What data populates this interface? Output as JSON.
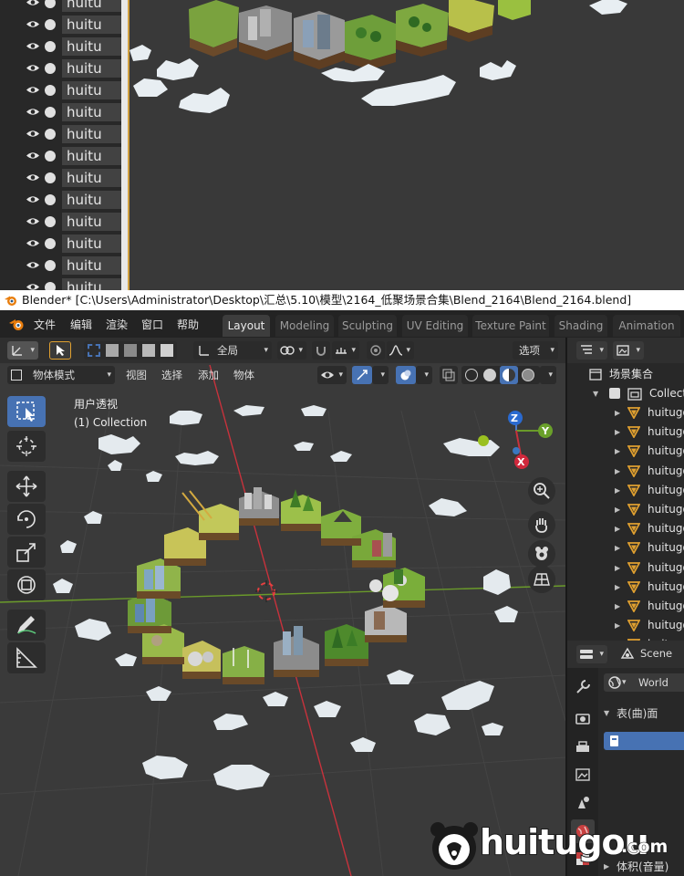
{
  "top_crop": {
    "rows": [
      "huitu",
      "huitu",
      "huitu",
      "huitu",
      "huitu",
      "huitu",
      "huitu",
      "huitu",
      "huitu",
      "huitu",
      "huitu",
      "huitu",
      "huitu",
      "huitu"
    ]
  },
  "title_bar": {
    "text": "Blender* [C:\\Users\\Administrator\\Desktop\\汇总\\5.10\\模型\\2164_低聚场景合集\\Blend_2164\\Blend_2164.blend]"
  },
  "menu": {
    "items": [
      "文件",
      "编辑",
      "渲染",
      "窗口",
      "帮助"
    ],
    "workspaces": [
      "Layout",
      "Modeling",
      "Sculpting",
      "UV Editing",
      "Texture Paint",
      "Shading",
      "Animation"
    ],
    "active_workspace": "Layout"
  },
  "viewport_header": {
    "pivot_label": "全局",
    "options_label": "选项",
    "mode_label": "物体模式",
    "menus": [
      "视图",
      "选择",
      "添加",
      "物体"
    ]
  },
  "viewport": {
    "view_name": "用户透视",
    "collection_label": "(1) Collection",
    "gizmo_axes": {
      "z": "Z",
      "y": "Y",
      "x": "X"
    }
  },
  "outliner": {
    "scene_collection": "场景集合",
    "collection": "Collection",
    "objects": [
      "huitugo",
      "huitugo",
      "huitugo",
      "huitugo",
      "huitugo",
      "huitugo",
      "huitugo",
      "huitugo",
      "huitugo",
      "huitugo",
      "huitugo",
      "huitugo",
      "huitugo"
    ]
  },
  "properties": {
    "scene_label": "Scene",
    "world_label": "World",
    "surface_panel": "表(曲)面",
    "volume_panel": "体积(音量)"
  },
  "watermark": {
    "text": "huitugou",
    "suffix": ".com"
  },
  "colors": {
    "accent_blue": "#4772b3",
    "active_orange": "#e0a030",
    "axis_red": "#c8323c",
    "axis_green": "#6a9a2a"
  }
}
